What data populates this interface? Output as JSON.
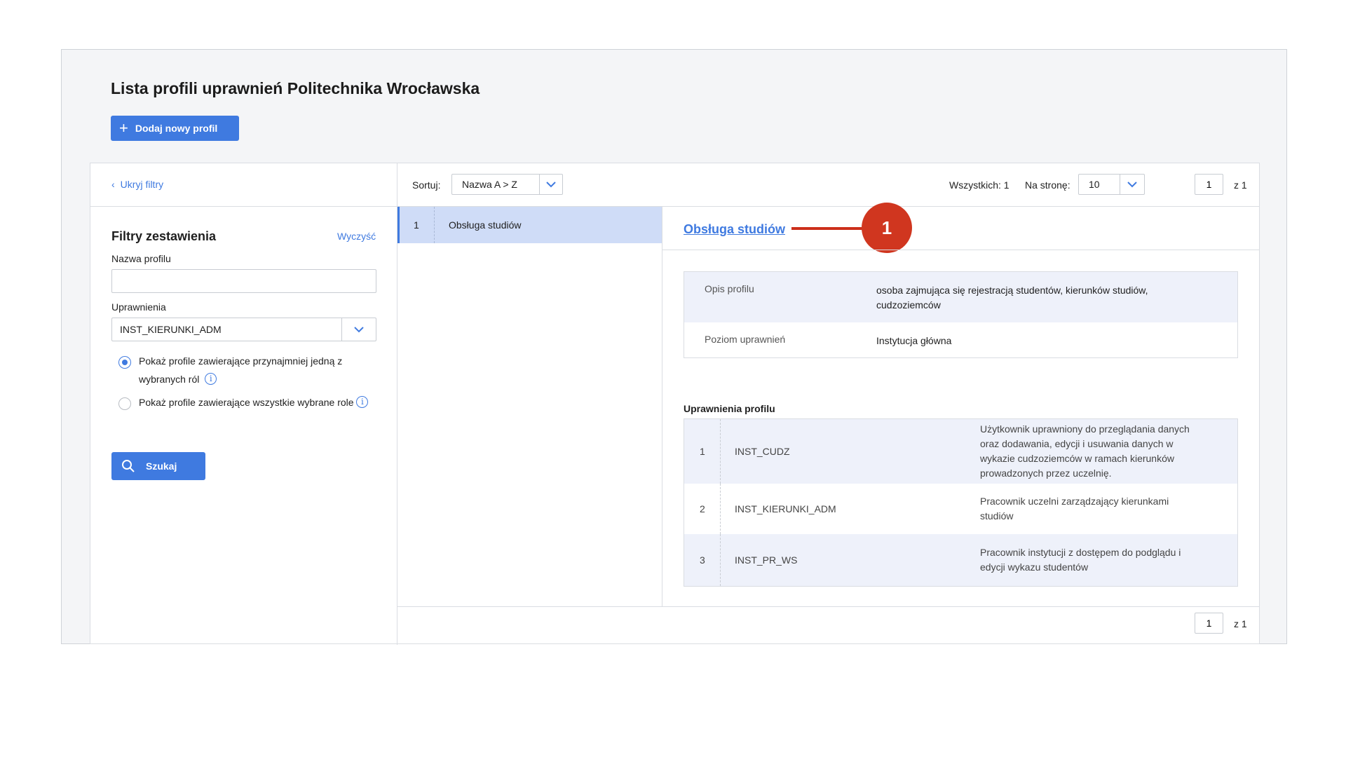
{
  "page": {
    "title": "Lista profili uprawnień Politechnika Wrocławska",
    "add_button": "Dodaj nowy profil"
  },
  "filters": {
    "hide_label": "Ukryj filtry",
    "title": "Filtry zestawienia",
    "clear_label": "Wyczyść",
    "profile_name_label": "Nazwa profilu",
    "profile_name_value": "",
    "permissions_label": "Uprawnienia",
    "permissions_value": "INST_KIERUNKI_ADM",
    "radio_any": "Pokaż profile zawierające przynajmniej jedną z wybranych ról",
    "radio_all": "Pokaż profile zawierające wszystkie wybrane role",
    "radio_selected": "any",
    "search_button": "Szukaj"
  },
  "toolbar": {
    "sort_label": "Sortuj:",
    "sort_value": "Nazwa A > Z",
    "total_label": "Wszystkich: 1",
    "per_page_label": "Na stronę:",
    "per_page_value": "10",
    "page_value": "1",
    "page_of": "z  1"
  },
  "list": {
    "items": [
      {
        "num": "1",
        "name": "Obsługa studiów",
        "selected": true
      }
    ]
  },
  "detail": {
    "title": "Obsługa studiów",
    "callout": "1",
    "info": [
      {
        "key": "Opis profilu",
        "value": "osoba zajmująca się rejestracją studentów, kierunków studiów, cudzoziemców"
      },
      {
        "key": "Poziom uprawnień",
        "value": "Instytucja główna"
      }
    ],
    "permissions_title": "Uprawnienia profilu",
    "permissions": [
      {
        "num": "1",
        "code": "INST_CUDZ",
        "desc": "Użytkownik uprawniony do przeglądania danych oraz dodawania, edycji i usuwania danych w wykazie cudzoziemców w ramach kierunków prowadzonych przez uczelnię."
      },
      {
        "num": "2",
        "code": "INST_KIERUNKI_ADM",
        "desc": "Pracownik uczelni zarządzający kierunkami studiów"
      },
      {
        "num": "3",
        "code": "INST_PR_WS",
        "desc": "Pracownik instytucji z dostępem do podglądu i edycji wykazu studentów"
      }
    ]
  },
  "pagination_bottom": {
    "page_value": "1",
    "page_of": "z  1"
  },
  "colors": {
    "accent": "#3f7ae0",
    "selected_row": "#cfdcf7",
    "callout": "#d0361f"
  }
}
